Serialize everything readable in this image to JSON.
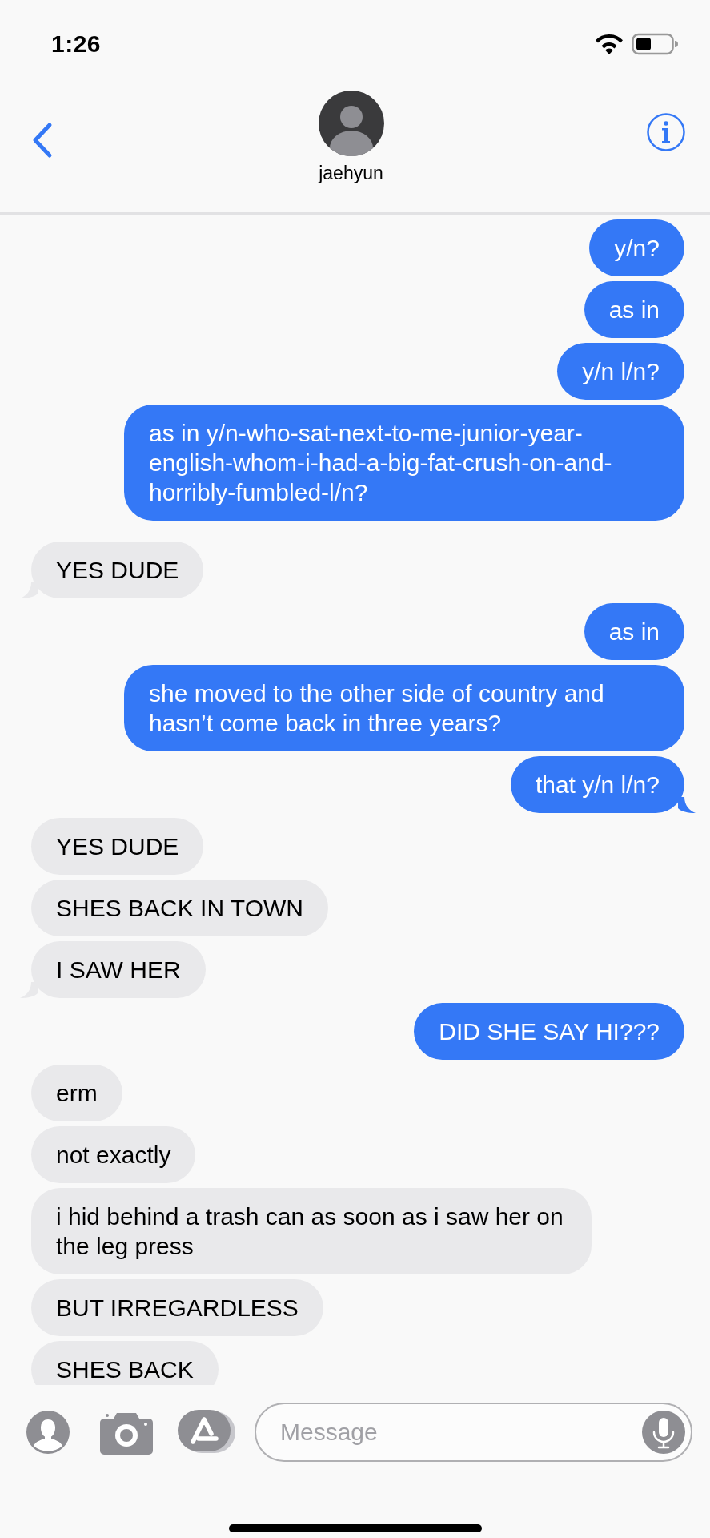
{
  "status_bar": {
    "time": "1:26"
  },
  "header": {
    "contact_name": "jaehyun"
  },
  "messages": [
    {
      "text": "y/n?",
      "kind": "sent",
      "tail": false
    },
    {
      "text": "as in",
      "kind": "sent",
      "tail": false
    },
    {
      "text": "y/n l/n?",
      "kind": "sent",
      "tail": false
    },
    {
      "text": "as in y/n-who-sat-next-to-me-junior-year-english-whom-i-had-a-big-fat-crush-on-and-horribly-fumbled-l/n?",
      "kind": "sent",
      "tail": false
    },
    {
      "text": "YES DUDE",
      "kind": "received",
      "tail": true
    },
    {
      "text": "as in",
      "kind": "sent",
      "tail": false
    },
    {
      "text": "she moved to the other side of country and hasn’t come back in three years?",
      "kind": "sent",
      "tail": false
    },
    {
      "text": "that y/n l/n?",
      "kind": "sent",
      "tail": true
    },
    {
      "text": "YES DUDE",
      "kind": "received",
      "tail": false
    },
    {
      "text": "SHES BACK IN TOWN",
      "kind": "received",
      "tail": false
    },
    {
      "text": "I SAW HER",
      "kind": "received",
      "tail": true
    },
    {
      "text": "DID SHE SAY HI???",
      "kind": "sent",
      "tail": false
    },
    {
      "text": "erm",
      "kind": "received",
      "tail": false
    },
    {
      "text": "not exactly",
      "kind": "received",
      "tail": false
    },
    {
      "text": "i hid behind a trash can as soon as i saw her on the leg press",
      "kind": "received",
      "tail": false
    },
    {
      "text": "BUT IRREGARDLESS",
      "kind": "received",
      "tail": false
    },
    {
      "text": "SHES BACK",
      "kind": "received",
      "tail": false
    }
  ],
  "composer": {
    "placeholder": "Message"
  }
}
